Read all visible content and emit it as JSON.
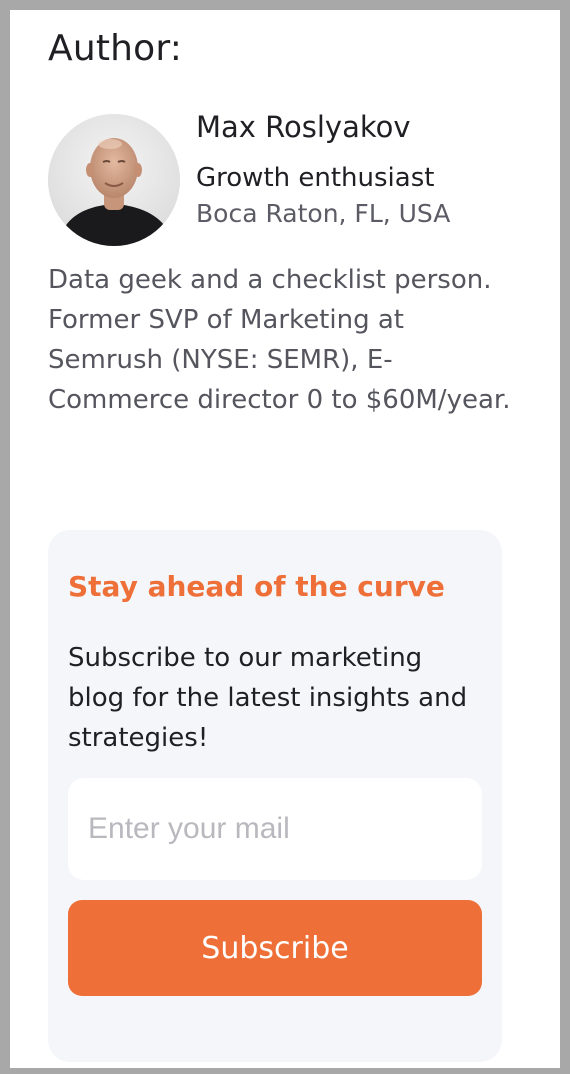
{
  "author_section": {
    "title": "Author:",
    "name": "Max Roslyakov",
    "role": "Growth enthusiast",
    "location": "Boca Raton, FL, USA",
    "bio": "Data geek and a checklist person. Former SVP of Marketing at Semrush (NYSE: SEMR), E-Commerce director 0 to $60M/year."
  },
  "newsletter": {
    "title": "Stay ahead of the curve",
    "description": "Subscribe to our marketing blog for the latest insights and strategies!",
    "email_placeholder": "Enter your mail",
    "email_value": "",
    "subscribe_label": "Subscribe"
  },
  "colors": {
    "accent": "#ee6f37",
    "card_background": "#f5f6fa",
    "text_primary": "#1f1f24",
    "text_secondary": "#5c5c66"
  },
  "icons": {
    "avatar": "author-photo"
  }
}
